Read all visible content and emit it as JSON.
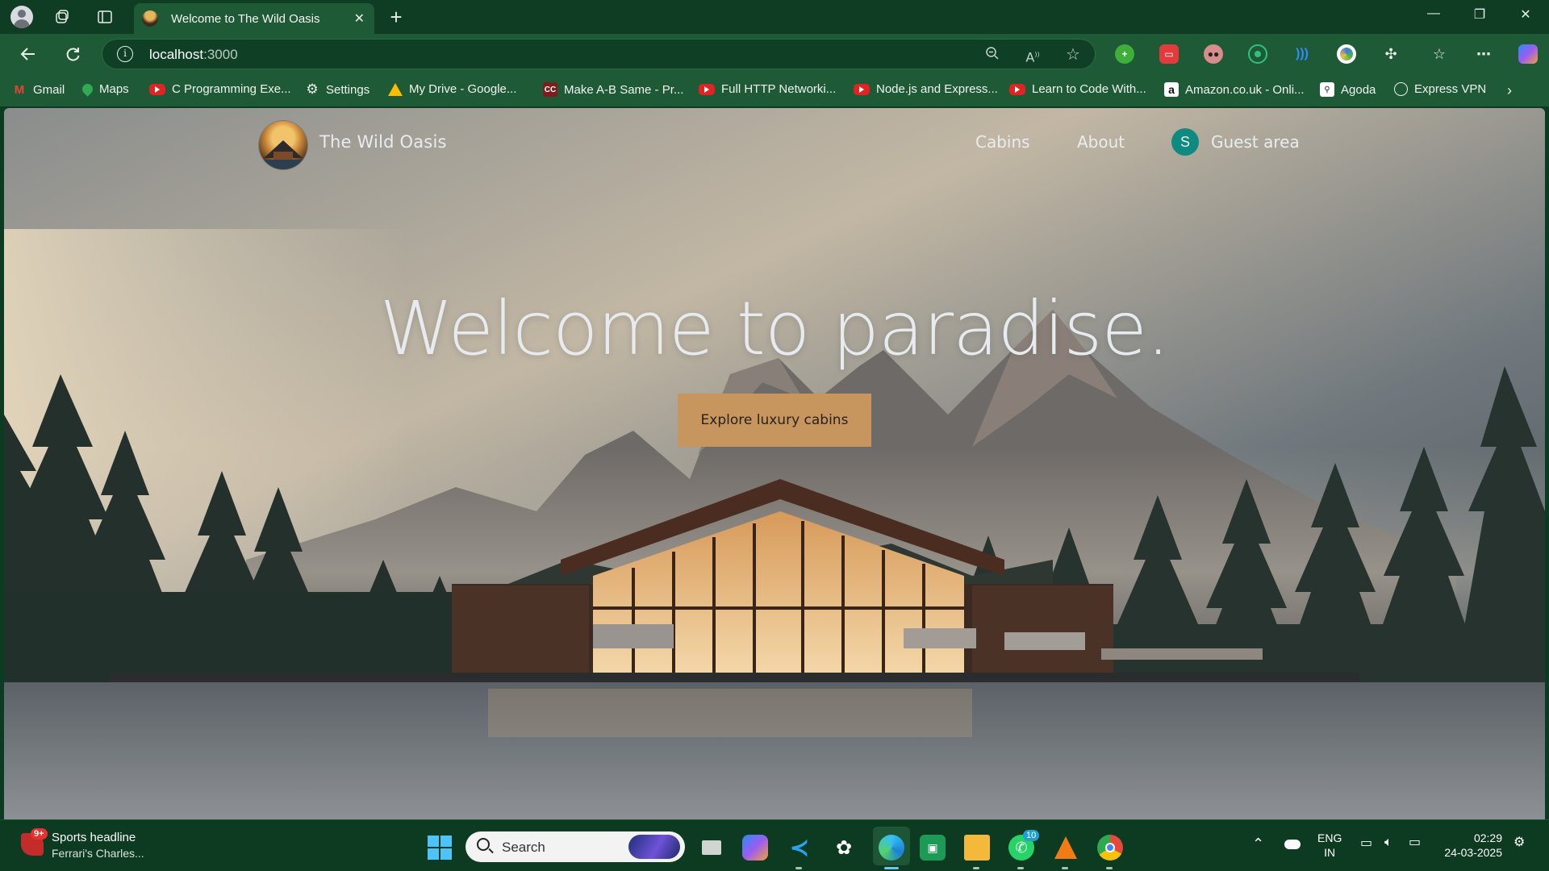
{
  "browser": {
    "tab": {
      "title": "Welcome to The Wild Oasis",
      "close": "✕"
    },
    "new_tab": "+",
    "window_controls": {
      "minimize": "—",
      "restore": "❐",
      "close": "✕"
    },
    "address": {
      "host": "localhost",
      "port": ":3000"
    },
    "bookmarks": [
      {
        "label": "Gmail",
        "icon": "gmail-icon"
      },
      {
        "label": "Maps",
        "icon": "maps-icon"
      },
      {
        "label": "C Programming Exe...",
        "icon": "youtube-icon"
      },
      {
        "label": "Settings",
        "icon": "gear-icon"
      },
      {
        "label": "My Drive - Google...",
        "icon": "drive-icon"
      },
      {
        "label": "Make A-B Same - Pr...",
        "icon": "cc-icon"
      },
      {
        "label": "Full HTTP Networki...",
        "icon": "youtube-icon"
      },
      {
        "label": "Node.js and Express...",
        "icon": "youtube-icon"
      },
      {
        "label": "Learn to Code With...",
        "icon": "youtube-icon"
      },
      {
        "label": "Amazon.co.uk - Onli...",
        "icon": "amazon-icon"
      },
      {
        "label": "Agoda",
        "icon": "agoda-icon"
      },
      {
        "label": "Express VPN",
        "icon": "globe-icon"
      }
    ]
  },
  "site": {
    "brand": "The Wild Oasis",
    "nav": {
      "cabins": "Cabins",
      "about": "About",
      "guest_area": "Guest area",
      "avatar_initial": "S"
    },
    "hero": {
      "title": "Welcome to paradise.",
      "cta": "Explore luxury cabins"
    }
  },
  "taskbar": {
    "news": {
      "badge": "9+",
      "title": "Sports headline",
      "subtitle": "Ferrari's Charles..."
    },
    "search_label": "Search",
    "whatsapp_badge": "10",
    "lang_line1": "ENG",
    "lang_line2": "IN",
    "time": "02:29",
    "date": "24-03-2025"
  },
  "colors": {
    "chrome_dark": "#0e3d24",
    "chrome_toolbar": "#1f5a37",
    "cta_background": "#c6965e",
    "avatar": "#0f8a80"
  }
}
